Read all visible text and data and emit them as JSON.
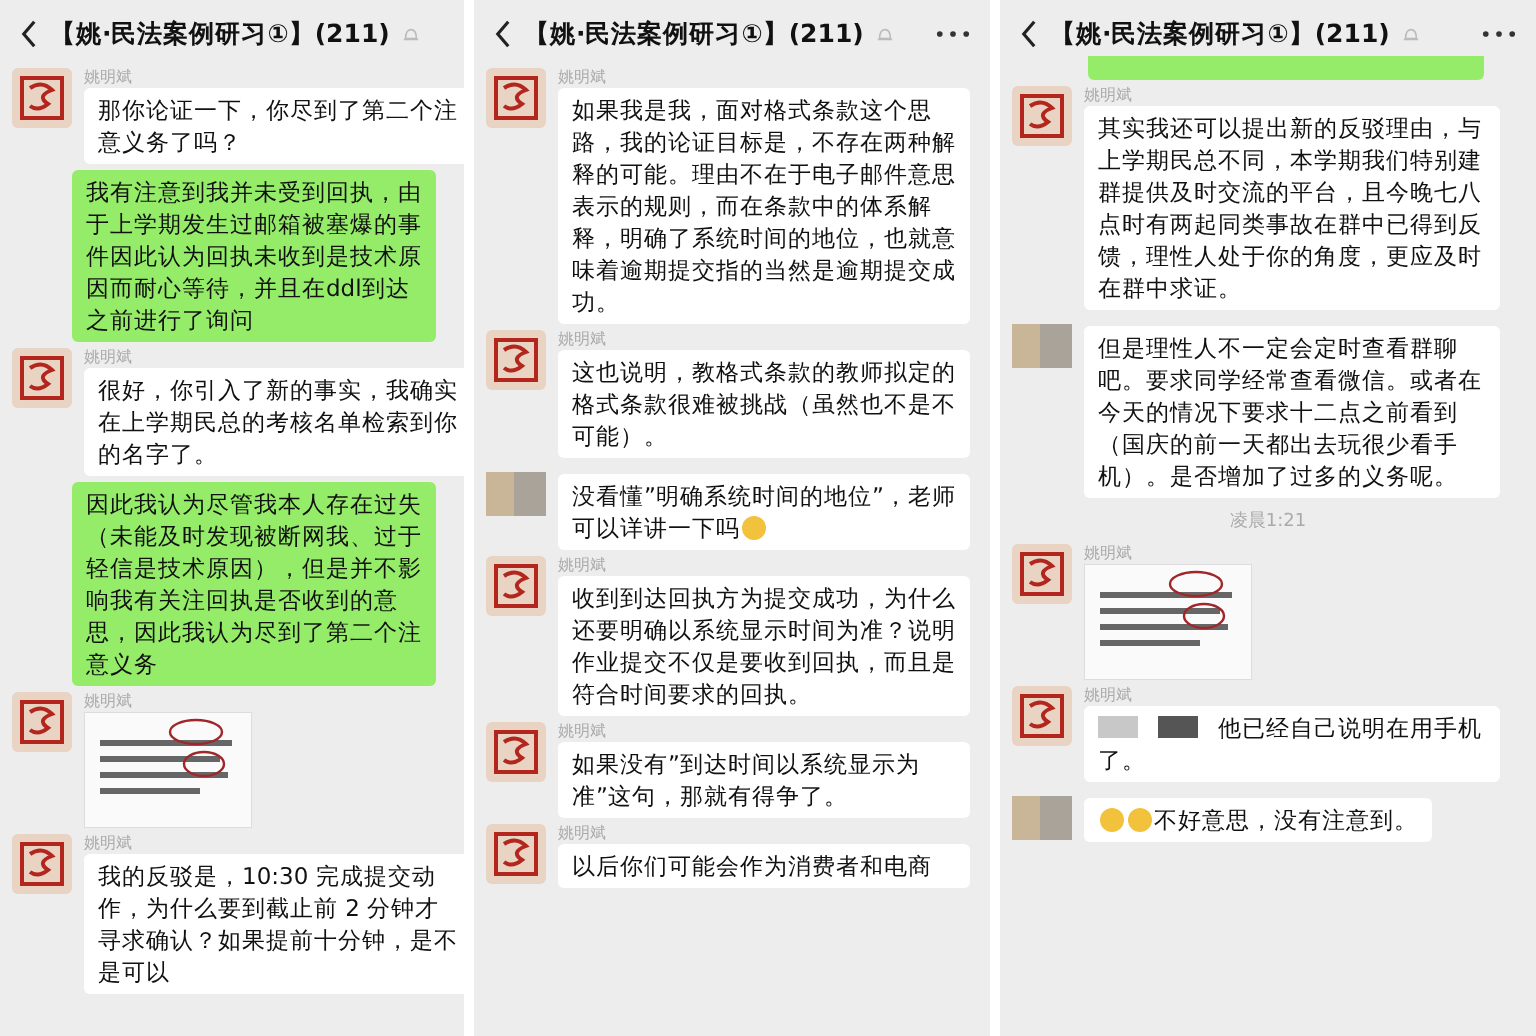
{
  "panels": [
    {
      "title": "【姚·民法案例研习①】(211)",
      "more": false,
      "top_edge": false,
      "items": [
        {
          "kind": "text",
          "avatar_blurred": false,
          "sender": "姚明斌",
          "text": "那你论证一下，你尽到了第二个注意义务了吗？"
        },
        {
          "kind": "mine",
          "text": "我有注意到我并未受到回执，由于上学期发生过邮箱被塞爆的事件因此认为回执未收到是技术原因而耐心等待，并且在ddl到达之前进行了询问"
        },
        {
          "kind": "text",
          "avatar_blurred": false,
          "sender": "姚明斌",
          "text": "很好，你引入了新的事实，我确实在上学期民总的考核名单检索到你的名字了。"
        },
        {
          "kind": "mine",
          "text": "因此我认为尽管我本人存在过失（未能及时发现被断网我、过于轻信是技术原因），但是并不影响我有关注回执是否收到的意思，因此我认为尽到了第二个注意义务"
        },
        {
          "kind": "image",
          "avatar_blurred": false,
          "sender": "姚明斌"
        },
        {
          "kind": "text",
          "avatar_blurred": false,
          "sender": "姚明斌",
          "text": "我的反驳是，10:30 完成提交动作，为什么要到截止前 2 分钟才寻求确认？如果提前十分钟，是不是可以"
        }
      ]
    },
    {
      "title": "【姚·民法案例研习①】(211)",
      "more": true,
      "top_edge": false,
      "items": [
        {
          "kind": "text",
          "avatar_blurred": false,
          "sender": "姚明斌",
          "text": "如果我是我，面对格式条款这个思路，我的论证目标是，不存在两种解释的可能。理由不在于电子邮件意思表示的规则，而在条款中的体系解释，明确了系统时间的地位，也就意味着逾期提交指的当然是逾期提交成功。"
        },
        {
          "kind": "text",
          "avatar_blurred": false,
          "sender": "姚明斌",
          "text": "这也说明，教格式条款的教师拟定的格式条款很难被挑战（虽然也不是不可能）。"
        },
        {
          "kind": "text",
          "avatar_blurred": true,
          "text": "没看懂”明确系统时间的地位”，老师可以详讲一下吗",
          "emoji_end": true
        },
        {
          "kind": "text",
          "avatar_blurred": false,
          "sender": "姚明斌",
          "text": "收到到达回执方为提交成功，为什么还要明确以系统显示时间为准？说明作业提交不仅是要收到回执，而且是符合时间要求的回执。"
        },
        {
          "kind": "text",
          "avatar_blurred": false,
          "sender": "姚明斌",
          "text": "如果没有”到达时间以系统显示为准”这句，那就有得争了。"
        },
        {
          "kind": "text",
          "avatar_blurred": false,
          "sender": "姚明斌",
          "text": "以后你们可能会作为消费者和电商"
        }
      ]
    },
    {
      "title": "【姚·民法案例研习①】(211)",
      "more": true,
      "top_edge": true,
      "items": [
        {
          "kind": "text",
          "avatar_blurred": false,
          "sender": "姚明斌",
          "text": "其实我还可以提出新的反驳理由，与上学期民总不同，本学期我们特别建群提供及时交流的平台，且今晚七八点时有两起同类事故在群中已得到反馈，理性人处于你的角度，更应及时在群中求证。"
        },
        {
          "kind": "text",
          "avatar_blurred": true,
          "text": "但是理性人不一定会定时查看群聊吧。要求同学经常查看微信。或者在今天的情况下要求十二点之前看到（国庆的前一天都出去玩很少看手机）。是否增加了过多的义务呢。"
        },
        {
          "kind": "time",
          "text": "凌晨1:21"
        },
        {
          "kind": "image",
          "avatar_blurred": false,
          "sender": "姚明斌"
        },
        {
          "kind": "text",
          "avatar_blurred": false,
          "sender": "姚明斌",
          "text": "他已经自己说明在用手机了。",
          "redacted_prefix": true
        },
        {
          "kind": "text",
          "avatar_blurred": true,
          "text": "不好意思，没有注意到。",
          "emoji_start": true
        }
      ]
    }
  ]
}
